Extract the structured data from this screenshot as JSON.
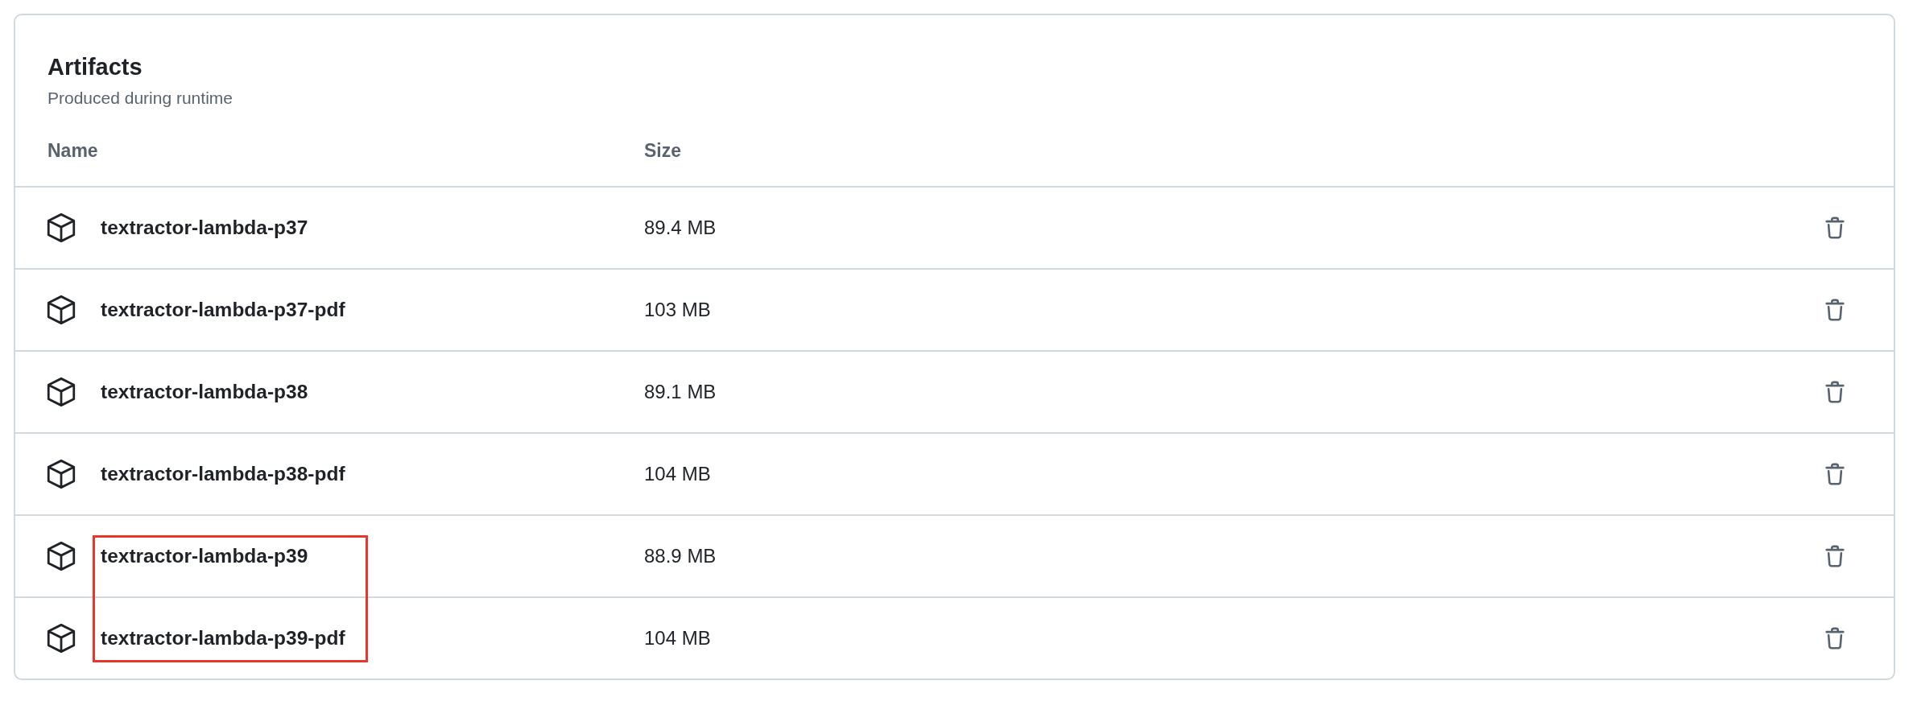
{
  "panel": {
    "title": "Artifacts",
    "subtitle": "Produced during runtime"
  },
  "table": {
    "columns": [
      "Name",
      "Size"
    ],
    "rows": [
      {
        "name": "textractor-lambda-p37",
        "size": "89.4 MB",
        "highlighted": false
      },
      {
        "name": "textractor-lambda-p37-pdf",
        "size": "103 MB",
        "highlighted": false
      },
      {
        "name": "textractor-lambda-p38",
        "size": "89.1 MB",
        "highlighted": false
      },
      {
        "name": "textractor-lambda-p38-pdf",
        "size": "104 MB",
        "highlighted": false
      },
      {
        "name": "textractor-lambda-p39",
        "size": "88.9 MB",
        "highlighted": true
      },
      {
        "name": "textractor-lambda-p39-pdf",
        "size": "104 MB",
        "highlighted": true
      }
    ]
  }
}
